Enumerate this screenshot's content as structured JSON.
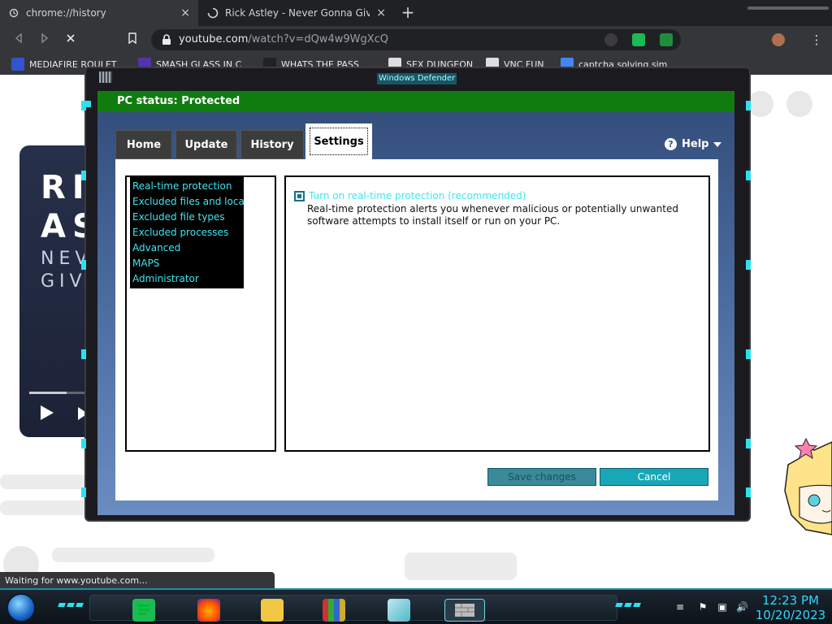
{
  "browser": {
    "tabs": [
      {
        "title": "chrome://history",
        "active": true
      },
      {
        "title": "Rick Astley - Never Gonna Give Yo",
        "active": false
      }
    ],
    "new_tab_symbol": "+",
    "close_symbol": "×",
    "url_host": "youtube.com",
    "url_path": "/watch?v=dQw4w9WgXcQ",
    "bookmarks": [
      {
        "label": "MEDIAFIRE ROULET",
        "icon_color": "#3355cc"
      },
      {
        "label": "SMASH GLASS IN C",
        "icon_color": "#5533aa"
      },
      {
        "label": "WHATS THE PASS",
        "icon_color": "#222222"
      },
      {
        "label": "SEX DUNGEON",
        "icon_color": "#dddddd"
      },
      {
        "label": "VNC FUN",
        "icon_color": "#dddddd"
      },
      {
        "label": "captcha solving sim",
        "icon_color": "#4285f4"
      }
    ],
    "status_text": "Waiting for www.youtube.com..."
  },
  "page": {
    "video_title_lines": [
      "RI",
      "AS"
    ],
    "video_sub_lines": [
      "NEV",
      "GIV"
    ],
    "video_progress_fraction": 0.55
  },
  "defender": {
    "window_title": "Windows Defender",
    "status_bar": "PC status: Protected",
    "status_color": "#107c10",
    "tabs": [
      {
        "label": "Home",
        "active": false
      },
      {
        "label": "Update",
        "active": false
      },
      {
        "label": "History",
        "active": false
      },
      {
        "label": "Settings",
        "active": true
      }
    ],
    "help_label": "Help",
    "settings_nav": [
      "Real-time protection",
      "Excluded files and locat...",
      "Excluded file types",
      "Excluded processes",
      "Advanced",
      "MAPS",
      "Administrator"
    ],
    "checkbox_label": "Turn on real-time protection (recommended)",
    "checkbox_checked": true,
    "description": "Real-time protection alerts you whenever malicious or potentially unwanted software attempts to install itself or run on your PC.",
    "save_button": "Save changes",
    "cancel_button": "Cancel",
    "accent_color": "#2de0f0"
  },
  "taskbar": {
    "time": "12:23 PM",
    "date": "10/20/2023"
  }
}
